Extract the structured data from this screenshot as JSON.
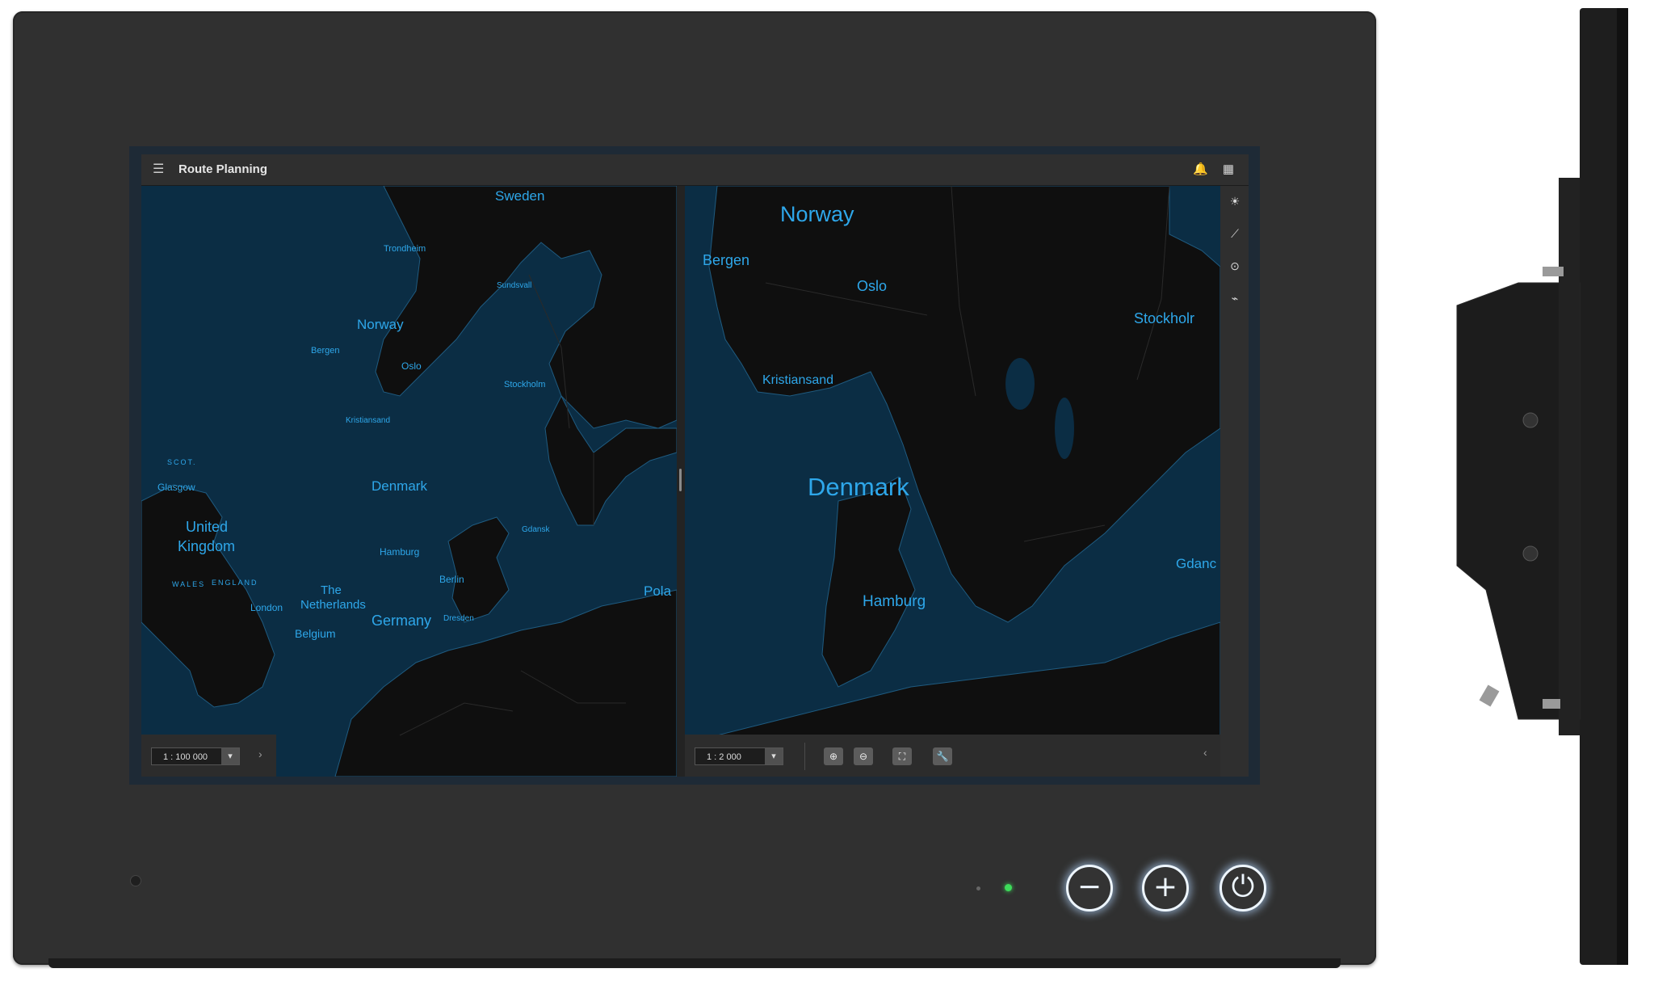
{
  "app": {
    "title": "Route Planning"
  },
  "icons": {
    "menu": "☰",
    "bell": "🔔",
    "apps": "▦",
    "sidebar": [
      "☀",
      "⟋",
      "⊙",
      "⌁"
    ]
  },
  "left_map": {
    "scale": "1 : 100 000",
    "labels": {
      "sweden": "Sweden",
      "trondheim": "Trondheim",
      "sundsvall": "Sundsvall",
      "norway": "Norway",
      "bergen": "Bergen",
      "oslo": "Oslo",
      "stockholm": "Stockholm",
      "kristiansand": "Kristiansand",
      "scot": "SCOT.",
      "glasgow": "Glasgow",
      "denmark": "Denmark",
      "united": "United",
      "kingdom": "Kingdom",
      "gdansk": "Gdansk",
      "hamburg": "Hamburg",
      "wales": "WALES",
      "england": "ENGLAND",
      "berlin": "Berlin",
      "the": "The",
      "netherlands": "Netherlands",
      "pola": "Pola",
      "london": "London",
      "germany": "Germany",
      "dresden": "Dresden",
      "belgium": "Belgium"
    }
  },
  "right_map": {
    "scale": "1 : 2 000",
    "labels": {
      "norway": "Norway",
      "bergen": "Bergen",
      "oslo": "Oslo",
      "stockholm": "Stockholr",
      "kristiansand": "Kristiansand",
      "denmark": "Denmark",
      "gdansk": "Gdanc",
      "hamburg": "Hamburg"
    },
    "toolbar": {
      "zoom_in": "⊕",
      "zoom_out": "⊖",
      "fit": "⛶",
      "tools": "🔧"
    }
  },
  "hardware": {
    "minus": "−",
    "plus": "+",
    "power": "⏻"
  },
  "colors": {
    "land": "#0f0f0f",
    "water": "#0b2d44",
    "label": "#2ea7ea",
    "led": "#3ddc5a"
  }
}
